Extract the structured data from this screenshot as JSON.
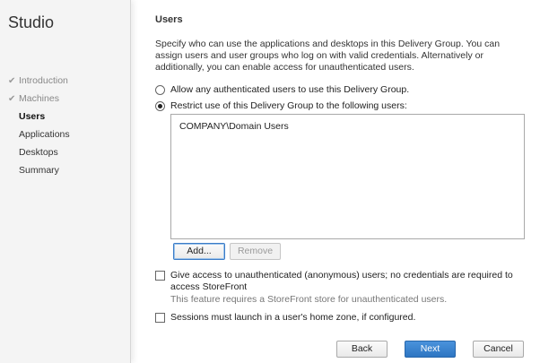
{
  "app": {
    "title": "Studio"
  },
  "steps": [
    {
      "label": "Introduction",
      "state": "done"
    },
    {
      "label": "Machines",
      "state": "done"
    },
    {
      "label": "Users",
      "state": "active"
    },
    {
      "label": "Applications",
      "state": "pending"
    },
    {
      "label": "Desktops",
      "state": "pending"
    },
    {
      "label": "Summary",
      "state": "pending"
    }
  ],
  "page": {
    "title": "Users",
    "description": "Specify who can use the applications and desktops in this Delivery Group. You can assign users and user groups who log on with valid credentials. Alternatively or additionally, you can enable access for unauthenticated users."
  },
  "options": {
    "allow_any": {
      "label": "Allow any authenticated users to use this Delivery Group.",
      "selected": false
    },
    "restrict": {
      "label": "Restrict use of this Delivery Group to the following users:",
      "selected": true
    }
  },
  "users": [
    "COMPANY\\Domain Users"
  ],
  "list_buttons": {
    "add": "Add...",
    "remove": "Remove"
  },
  "unauthenticated": {
    "label": "Give access to unauthenticated (anonymous) users; no credentials are required to access StoreFront",
    "note": "This feature requires a StoreFront store for unauthenticated users.",
    "checked": false
  },
  "home_zone": {
    "label": "Sessions must launch in a user's home zone, if configured.",
    "checked": false
  },
  "footer": {
    "back": "Back",
    "next": "Next",
    "cancel": "Cancel"
  },
  "colors": {
    "primary": "#2d75c2",
    "sidebar_bg": "#f4f4f4"
  }
}
